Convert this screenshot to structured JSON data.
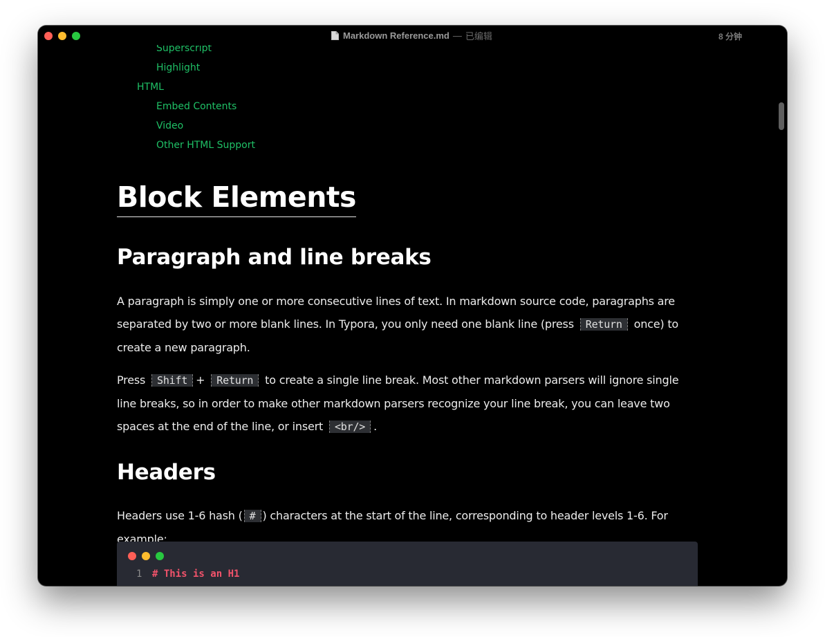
{
  "window": {
    "title": "Markdown Reference.md",
    "separator": "—",
    "status": "已编辑",
    "time": "8 分钟"
  },
  "toc": {
    "items": [
      {
        "label": "Superscript"
      },
      {
        "label": "Highlight"
      },
      {
        "label": "HTML"
      },
      {
        "label": "Embed Contents"
      },
      {
        "label": "Video"
      },
      {
        "label": "Other HTML Support"
      }
    ]
  },
  "doc": {
    "h1": "Block Elements",
    "h2_paragraph": "Paragraph and line breaks",
    "p1": {
      "before": "A paragraph is simply one or more consecutive lines of text. In markdown source code, paragraphs are separated by two or more blank lines. In Typora, you only need one blank line (press",
      "code": "Return",
      "after": "once) to create a new paragraph."
    },
    "p2": {
      "t1": "Press",
      "code1": "Shift",
      "plus": "+",
      "code2": "Return",
      "t2": "to create a single line break. Most other markdown parsers will ignore single line breaks, so in order to make other markdown parsers recognize your line break, you can leave two spaces at the end of the line, or insert",
      "code3": "<br/>",
      "t3": "."
    },
    "h2_headers": "Headers",
    "p3": {
      "before": "Headers use 1-6 hash (",
      "code": "#",
      "after": ") characters at the start of the line, corresponding to header levels 1-6. For example:"
    },
    "codeblock": {
      "line_number": "1",
      "line": "# This is an H1"
    }
  },
  "colors": {
    "background": "#000000",
    "toc_link": "#1fc066",
    "code_keyword": "#f2536b",
    "codeblock_bg": "#282a33"
  }
}
